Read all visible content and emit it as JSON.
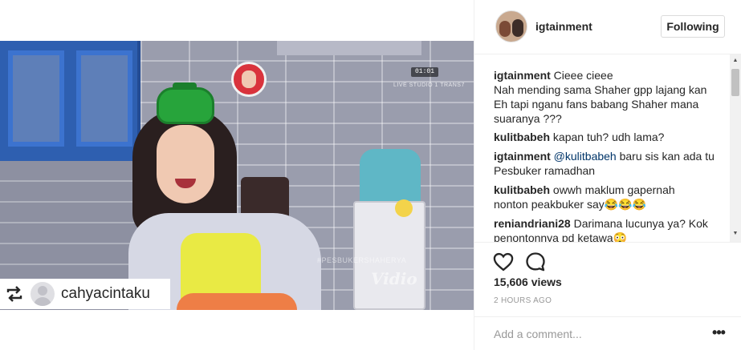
{
  "post": {
    "author": "igtainment",
    "follow_label": "Following",
    "views": "15,606 views",
    "time": "2 HOURS AGO",
    "comment_placeholder": "Add a comment...",
    "more_glyph": "•••"
  },
  "video": {
    "timestamp": "01:01",
    "live_side_text": "LIVE STUDIO 1 TRANS7",
    "watermark": "#PESBUKERSHAHERYA",
    "brand_mark": "Vidio"
  },
  "repost": {
    "username": "cahyacintaku",
    "icon": "repost-icon"
  },
  "comments": [
    {
      "user": "igtainment",
      "lines": [
        "Cieee cieee",
        "Nah mending sama Shaher gpp lajang kan",
        "Eh tapi nganu fans babang Shaher mana",
        "suaranya ???"
      ]
    },
    {
      "user": "kulitbabeh",
      "lines": [
        "kapan tuh? udh lama?"
      ]
    },
    {
      "user": "igtainment",
      "mention": "@kulitbabeh",
      "lines": [
        "baru sis kan ada tu",
        "Pesbuker ramadhan"
      ]
    },
    {
      "user": "kulitbabeh",
      "lines": [
        "owwh maklum gapernah",
        "nonton peakbuker say😂😂😂"
      ]
    },
    {
      "user": "reniandriani28",
      "lines": [
        "Darimana lucunya ya? Kok",
        "penontonnya pd ketawa😳"
      ]
    }
  ],
  "icons": {
    "like": "heart-icon",
    "comment": "comment-icon",
    "more": "more-options-icon"
  },
  "colors": {
    "text": "#262626",
    "muted": "#999999",
    "border": "#efefef",
    "mention": "#003569"
  }
}
